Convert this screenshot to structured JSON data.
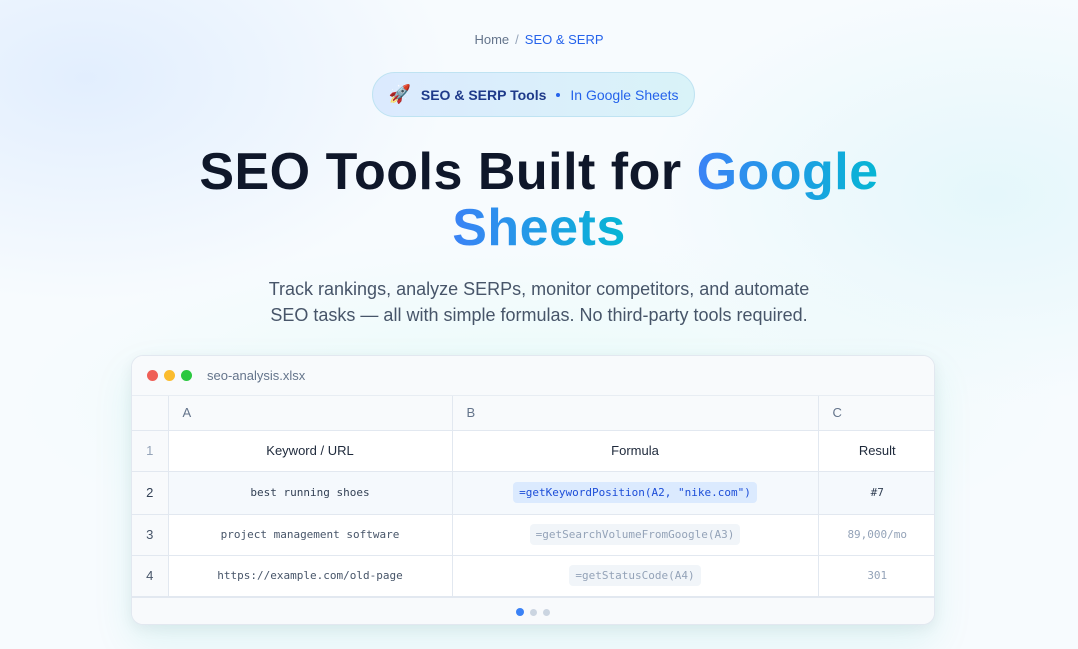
{
  "breadcrumb": {
    "home": "Home",
    "separator": "/",
    "current": "SEO & SERP"
  },
  "badge": {
    "icon": "rocket-icon",
    "label": "SEO & SERP Tools",
    "sublabel": "In Google Sheets"
  },
  "headline": {
    "part1": "SEO Tools Built for ",
    "highlight1": "Google",
    "highlight2": "Sheets"
  },
  "subtitle": {
    "line1": "Track rankings, analyze SERPs, monitor competitors, and automate",
    "line2": "SEO tasks — all with simple formulas. No third-party tools required."
  },
  "spreadsheet": {
    "filename": "seo-analysis.xlsx",
    "columns": [
      "A",
      "B",
      "C"
    ],
    "header_row": {
      "number": "1",
      "cells": [
        "Keyword / URL",
        "Formula",
        "Result"
      ]
    },
    "rows": [
      {
        "number": "2",
        "keyword": "best running shoes",
        "formula": "=getKeywordPosition(A2, \"nike.com\")",
        "result": "#7"
      },
      {
        "number": "3",
        "keyword": "project management software",
        "formula": "=getSearchVolumeFromGoogle(A3)",
        "result": "89,000/mo"
      },
      {
        "number": "4",
        "keyword": "https://example.com/old-page",
        "formula": "=getStatusCode(A4)",
        "result": "301"
      }
    ],
    "pagination": {
      "total": 3,
      "active_index": 1
    }
  },
  "colors": {
    "accent": "#2563eb",
    "gradient_start": "#3b82f6",
    "gradient_end": "#06b6d4",
    "traffic_red": "#ef5f57",
    "traffic_yellow": "#fbbc2e",
    "traffic_green": "#2bc840"
  }
}
